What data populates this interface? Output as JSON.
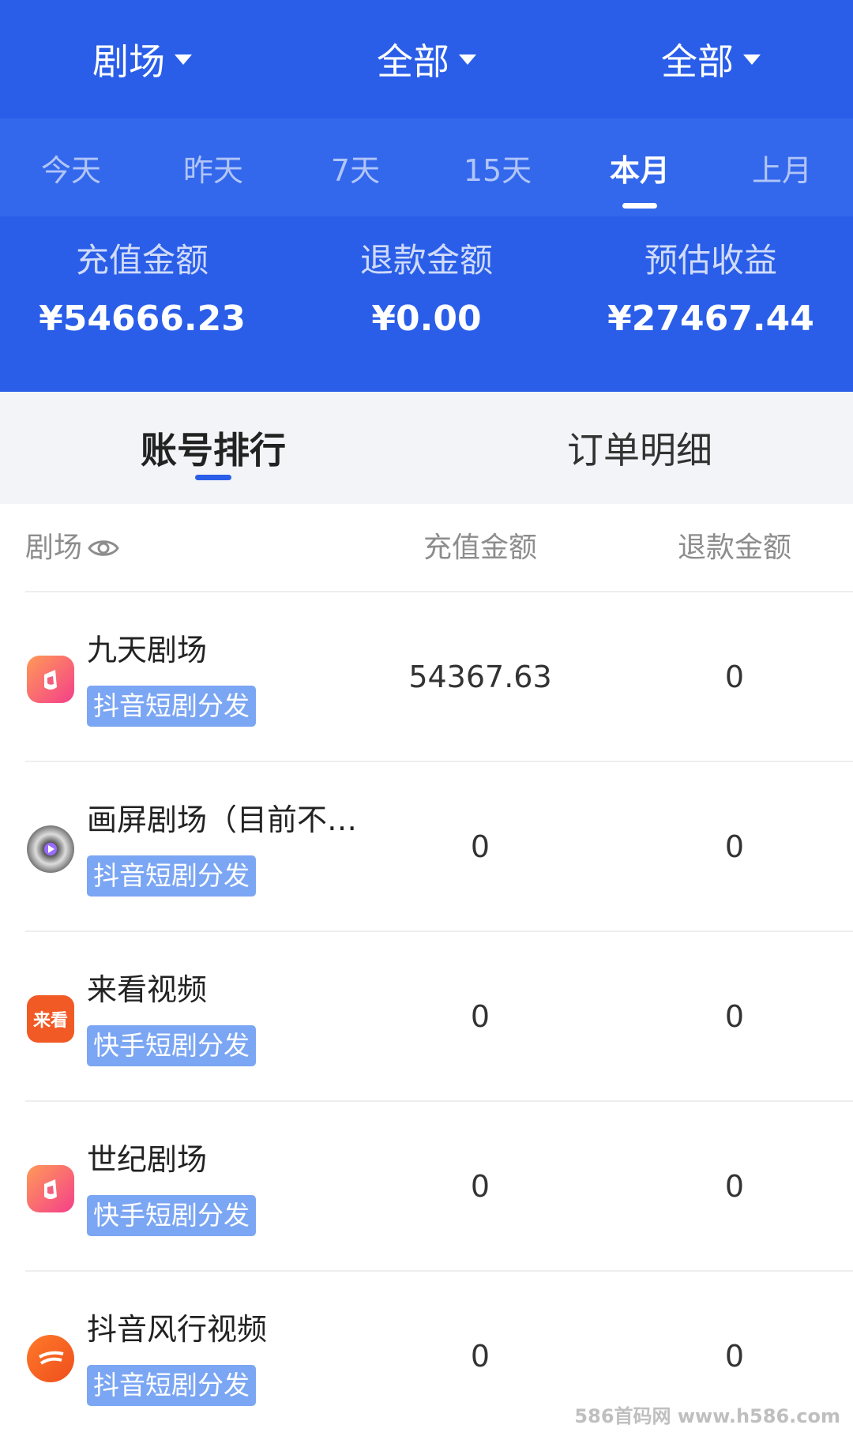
{
  "filters": [
    {
      "label": "剧场"
    },
    {
      "label": "全部"
    },
    {
      "label": "全部"
    }
  ],
  "date_tabs": [
    {
      "label": "今天",
      "active": false
    },
    {
      "label": "昨天",
      "active": false
    },
    {
      "label": "7天",
      "active": false
    },
    {
      "label": "15天",
      "active": false
    },
    {
      "label": "本月",
      "active": true
    },
    {
      "label": "上月",
      "active": false
    }
  ],
  "stats": [
    {
      "label": "充值金额",
      "value": "¥54666.23"
    },
    {
      "label": "退款金额",
      "value": "¥0.00"
    },
    {
      "label": "预估收益",
      "value": "¥27467.44"
    }
  ],
  "sub_tabs": [
    {
      "label": "账号排行",
      "active": true
    },
    {
      "label": "订单明细",
      "active": false
    }
  ],
  "table": {
    "headers": {
      "name": "剧场",
      "recharge": "充值金额",
      "refund": "退款金额"
    },
    "rows": [
      {
        "name": "九天剧场",
        "tag": "抖音短剧分发",
        "recharge": "54367.63",
        "refund": "0",
        "icon": "app-logo-icon"
      },
      {
        "name": "画屏剧场（目前不…",
        "tag": "抖音短剧分发",
        "recharge": "0",
        "refund": "0",
        "icon": "disc-logo-icon"
      },
      {
        "name": "来看视频",
        "tag": "快手短剧分发",
        "recharge": "0",
        "refund": "0",
        "icon": "laikan-logo-icon",
        "icon_text": "来看"
      },
      {
        "name": "世纪剧场",
        "tag": "快手短剧分发",
        "recharge": "0",
        "refund": "0",
        "icon": "app-logo-icon"
      },
      {
        "name": "抖音风行视频",
        "tag": "抖音短剧分发",
        "recharge": "0",
        "refund": "0",
        "icon": "fengxing-logo-icon"
      }
    ]
  },
  "watermark": "586首码网 www.h586.com",
  "colors": {
    "primary": "#2a5ee8",
    "tag": "#7ba6f3"
  }
}
